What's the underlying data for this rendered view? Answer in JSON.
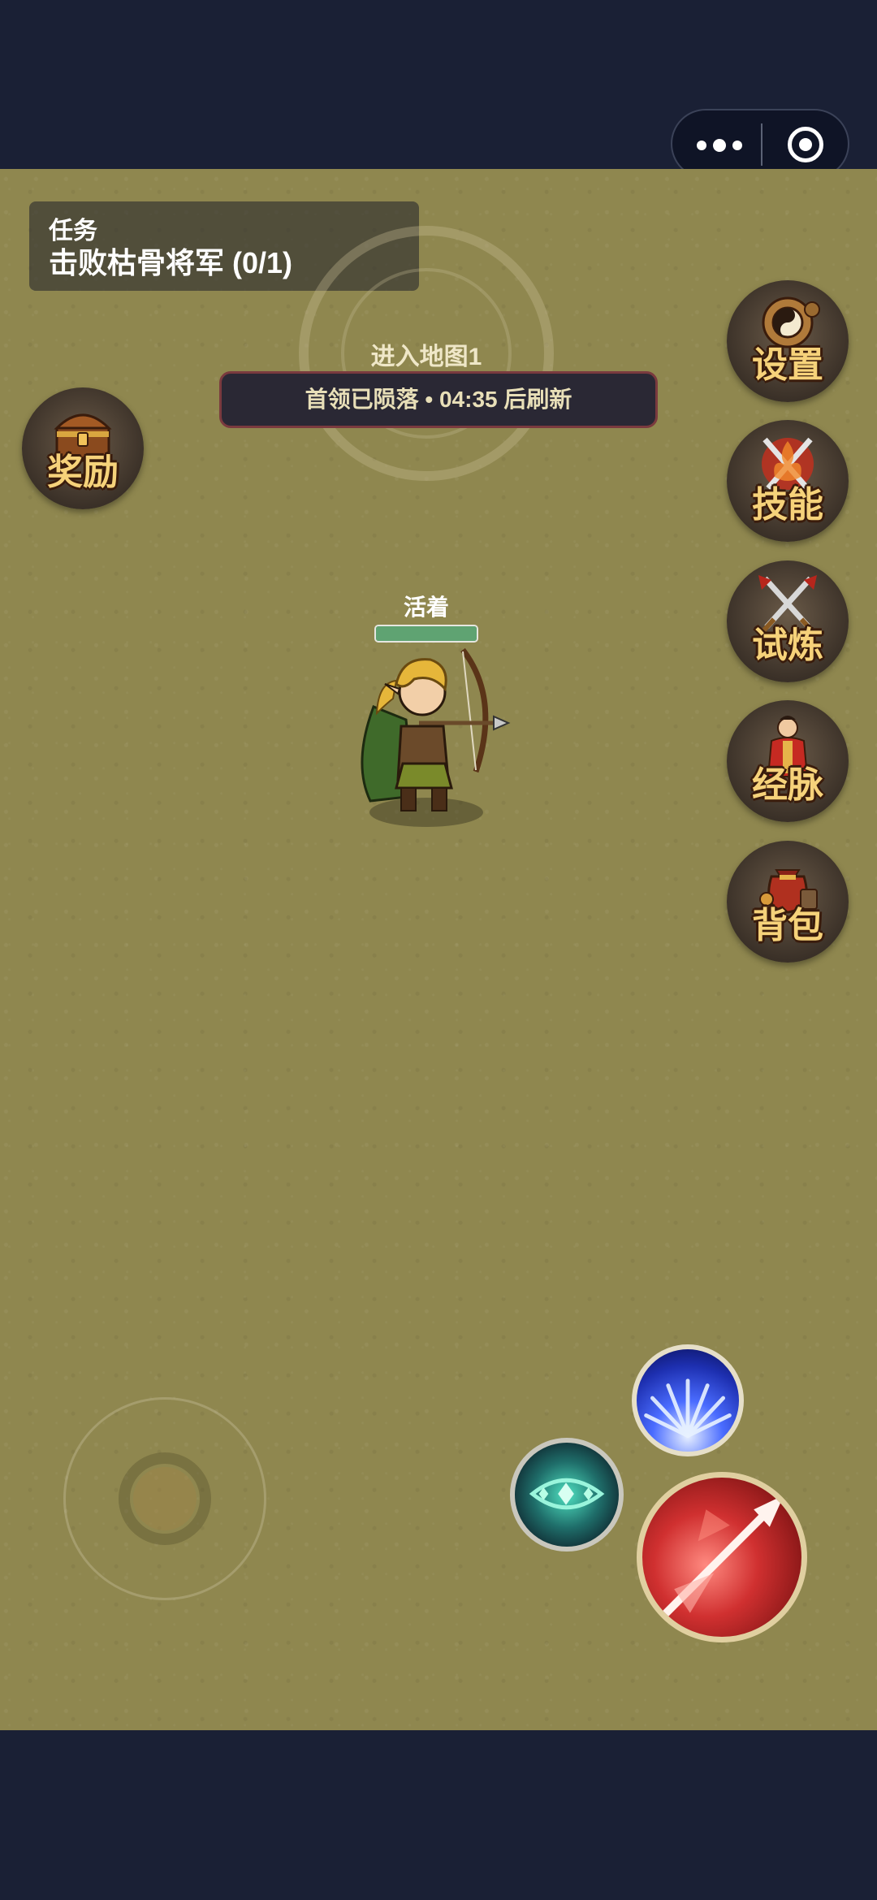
{
  "quest": {
    "label": "任务",
    "objective": "击败枯骨将军 (0/1)"
  },
  "map": {
    "title": "进入地图1"
  },
  "boss_banner": {
    "text": "首领已陨落 • 04:35 后刷新"
  },
  "side_buttons": {
    "reward": "奖励",
    "settings": "设置",
    "skills": "技能",
    "trial": "试炼",
    "meridian": "经脉",
    "bag": "背包"
  },
  "player": {
    "status": "活着",
    "hp_fraction": 1.0
  },
  "colors": {
    "field": "#8f874f",
    "frame": "#1a2035",
    "hp": "#5fa372",
    "label_gold": "#f6d27a"
  },
  "icons": {
    "capsule_menu": "more-dots-icon",
    "capsule_close": "target-circle-icon",
    "reward": "treasure-chest-icon",
    "settings": "gear-yinyang-icon",
    "skills": "crossed-swords-flame-icon",
    "trial": "crossed-swords-icon",
    "meridian": "martial-figure-icon",
    "bag": "loot-bag-icon"
  }
}
